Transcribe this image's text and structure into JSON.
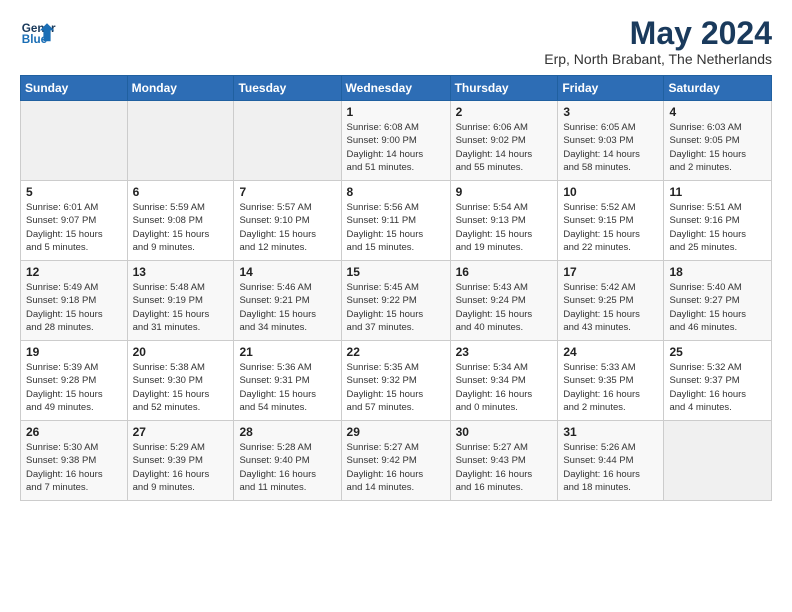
{
  "header": {
    "logo_line1": "General",
    "logo_line2": "Blue",
    "title": "May 2024",
    "location": "Erp, North Brabant, The Netherlands"
  },
  "weekdays": [
    "Sunday",
    "Monday",
    "Tuesday",
    "Wednesday",
    "Thursday",
    "Friday",
    "Saturday"
  ],
  "weeks": [
    [
      {
        "day": "",
        "info": ""
      },
      {
        "day": "",
        "info": ""
      },
      {
        "day": "",
        "info": ""
      },
      {
        "day": "1",
        "info": "Sunrise: 6:08 AM\nSunset: 9:00 PM\nDaylight: 14 hours\nand 51 minutes."
      },
      {
        "day": "2",
        "info": "Sunrise: 6:06 AM\nSunset: 9:02 PM\nDaylight: 14 hours\nand 55 minutes."
      },
      {
        "day": "3",
        "info": "Sunrise: 6:05 AM\nSunset: 9:03 PM\nDaylight: 14 hours\nand 58 minutes."
      },
      {
        "day": "4",
        "info": "Sunrise: 6:03 AM\nSunset: 9:05 PM\nDaylight: 15 hours\nand 2 minutes."
      }
    ],
    [
      {
        "day": "5",
        "info": "Sunrise: 6:01 AM\nSunset: 9:07 PM\nDaylight: 15 hours\nand 5 minutes."
      },
      {
        "day": "6",
        "info": "Sunrise: 5:59 AM\nSunset: 9:08 PM\nDaylight: 15 hours\nand 9 minutes."
      },
      {
        "day": "7",
        "info": "Sunrise: 5:57 AM\nSunset: 9:10 PM\nDaylight: 15 hours\nand 12 minutes."
      },
      {
        "day": "8",
        "info": "Sunrise: 5:56 AM\nSunset: 9:11 PM\nDaylight: 15 hours\nand 15 minutes."
      },
      {
        "day": "9",
        "info": "Sunrise: 5:54 AM\nSunset: 9:13 PM\nDaylight: 15 hours\nand 19 minutes."
      },
      {
        "day": "10",
        "info": "Sunrise: 5:52 AM\nSunset: 9:15 PM\nDaylight: 15 hours\nand 22 minutes."
      },
      {
        "day": "11",
        "info": "Sunrise: 5:51 AM\nSunset: 9:16 PM\nDaylight: 15 hours\nand 25 minutes."
      }
    ],
    [
      {
        "day": "12",
        "info": "Sunrise: 5:49 AM\nSunset: 9:18 PM\nDaylight: 15 hours\nand 28 minutes."
      },
      {
        "day": "13",
        "info": "Sunrise: 5:48 AM\nSunset: 9:19 PM\nDaylight: 15 hours\nand 31 minutes."
      },
      {
        "day": "14",
        "info": "Sunrise: 5:46 AM\nSunset: 9:21 PM\nDaylight: 15 hours\nand 34 minutes."
      },
      {
        "day": "15",
        "info": "Sunrise: 5:45 AM\nSunset: 9:22 PM\nDaylight: 15 hours\nand 37 minutes."
      },
      {
        "day": "16",
        "info": "Sunrise: 5:43 AM\nSunset: 9:24 PM\nDaylight: 15 hours\nand 40 minutes."
      },
      {
        "day": "17",
        "info": "Sunrise: 5:42 AM\nSunset: 9:25 PM\nDaylight: 15 hours\nand 43 minutes."
      },
      {
        "day": "18",
        "info": "Sunrise: 5:40 AM\nSunset: 9:27 PM\nDaylight: 15 hours\nand 46 minutes."
      }
    ],
    [
      {
        "day": "19",
        "info": "Sunrise: 5:39 AM\nSunset: 9:28 PM\nDaylight: 15 hours\nand 49 minutes."
      },
      {
        "day": "20",
        "info": "Sunrise: 5:38 AM\nSunset: 9:30 PM\nDaylight: 15 hours\nand 52 minutes."
      },
      {
        "day": "21",
        "info": "Sunrise: 5:36 AM\nSunset: 9:31 PM\nDaylight: 15 hours\nand 54 minutes."
      },
      {
        "day": "22",
        "info": "Sunrise: 5:35 AM\nSunset: 9:32 PM\nDaylight: 15 hours\nand 57 minutes."
      },
      {
        "day": "23",
        "info": "Sunrise: 5:34 AM\nSunset: 9:34 PM\nDaylight: 16 hours\nand 0 minutes."
      },
      {
        "day": "24",
        "info": "Sunrise: 5:33 AM\nSunset: 9:35 PM\nDaylight: 16 hours\nand 2 minutes."
      },
      {
        "day": "25",
        "info": "Sunrise: 5:32 AM\nSunset: 9:37 PM\nDaylight: 16 hours\nand 4 minutes."
      }
    ],
    [
      {
        "day": "26",
        "info": "Sunrise: 5:30 AM\nSunset: 9:38 PM\nDaylight: 16 hours\nand 7 minutes."
      },
      {
        "day": "27",
        "info": "Sunrise: 5:29 AM\nSunset: 9:39 PM\nDaylight: 16 hours\nand 9 minutes."
      },
      {
        "day": "28",
        "info": "Sunrise: 5:28 AM\nSunset: 9:40 PM\nDaylight: 16 hours\nand 11 minutes."
      },
      {
        "day": "29",
        "info": "Sunrise: 5:27 AM\nSunset: 9:42 PM\nDaylight: 16 hours\nand 14 minutes."
      },
      {
        "day": "30",
        "info": "Sunrise: 5:27 AM\nSunset: 9:43 PM\nDaylight: 16 hours\nand 16 minutes."
      },
      {
        "day": "31",
        "info": "Sunrise: 5:26 AM\nSunset: 9:44 PM\nDaylight: 16 hours\nand 18 minutes."
      },
      {
        "day": "",
        "info": ""
      }
    ]
  ]
}
